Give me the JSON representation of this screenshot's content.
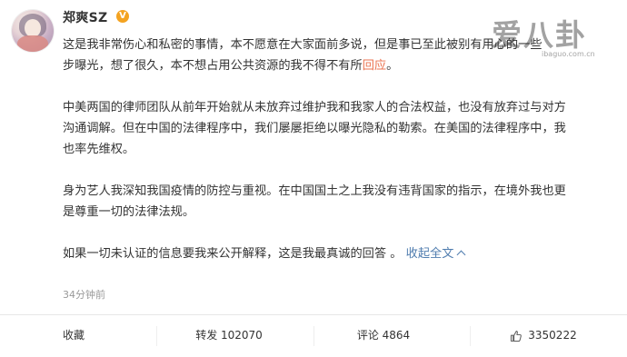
{
  "post": {
    "username": "郑爽SZ",
    "verified_badge": "V",
    "paragraphs": {
      "p1_a": "这是我非常伤心和私密的事情，本不愿意在大家面前多说，但是事已至此被别有用心的一些",
      "p1_b": "步曝光，想了很久，本不想占用公共资源的我不得不有所",
      "p1_link": "回应",
      "p1_end": "。",
      "p2_a": "中美两国的律师团队从前年开始就从未放弃过维护我和我家人的合法权益，也没有放弃过与对方",
      "p2_b": "沟通调解。但在中国的法律程序中，我们屡屡拒绝以曝光隐私的勒索。在美国的法律程序中，我",
      "p2_c": "也率先维权。",
      "p3_a": "身为艺人我深知我国疫情的防控与重视。在中国国土之上我没有违背国家的指示，在境外我也更",
      "p3_b": "是尊重一切的法律法规。",
      "p4_a": "如果一切未认证的信息要我来公开解释，这是我最真诚的回答 。",
      "p4_collapse": "收起全文"
    },
    "timestamp": "34分钟前"
  },
  "watermark": {
    "title": "爱八卦",
    "subtitle": "ibaguo.com.cn"
  },
  "footer": {
    "favorite_label": "收藏",
    "repost_label": "转发 102070",
    "comment_label": "评论 4864",
    "like_count": "3350222"
  },
  "colors": {
    "link": "#eb7350",
    "blue": "#507daf",
    "badge": "#f4a321",
    "text": "#333333",
    "muted": "#999999"
  }
}
